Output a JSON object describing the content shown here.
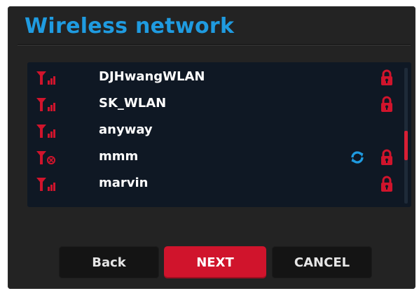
{
  "dialog": {
    "title": "Wireless network"
  },
  "networks": [
    {
      "ssid": "DJHwangWLAN",
      "signal_icon": "wifi-signal-strong-icon",
      "secured": true,
      "connecting": false
    },
    {
      "ssid": "SK_WLAN",
      "signal_icon": "wifi-signal-strong-icon",
      "secured": true,
      "connecting": false
    },
    {
      "ssid": "anyway",
      "signal_icon": "wifi-signal-strong-icon",
      "secured": false,
      "connecting": false
    },
    {
      "ssid": "mmm",
      "signal_icon": "wifi-signal-error-icon",
      "secured": true,
      "connecting": true
    },
    {
      "ssid": "marvin",
      "signal_icon": "wifi-signal-strong-icon",
      "secured": true,
      "connecting": false
    }
  ],
  "buttons": {
    "back": "Back",
    "next": "NEXT",
    "cancel": "CANCEL"
  },
  "colors": {
    "accent_blue": "#1f9be0",
    "accent_red": "#d0142c",
    "panel_bg": "#0f1824",
    "dialog_bg": "#232323"
  }
}
